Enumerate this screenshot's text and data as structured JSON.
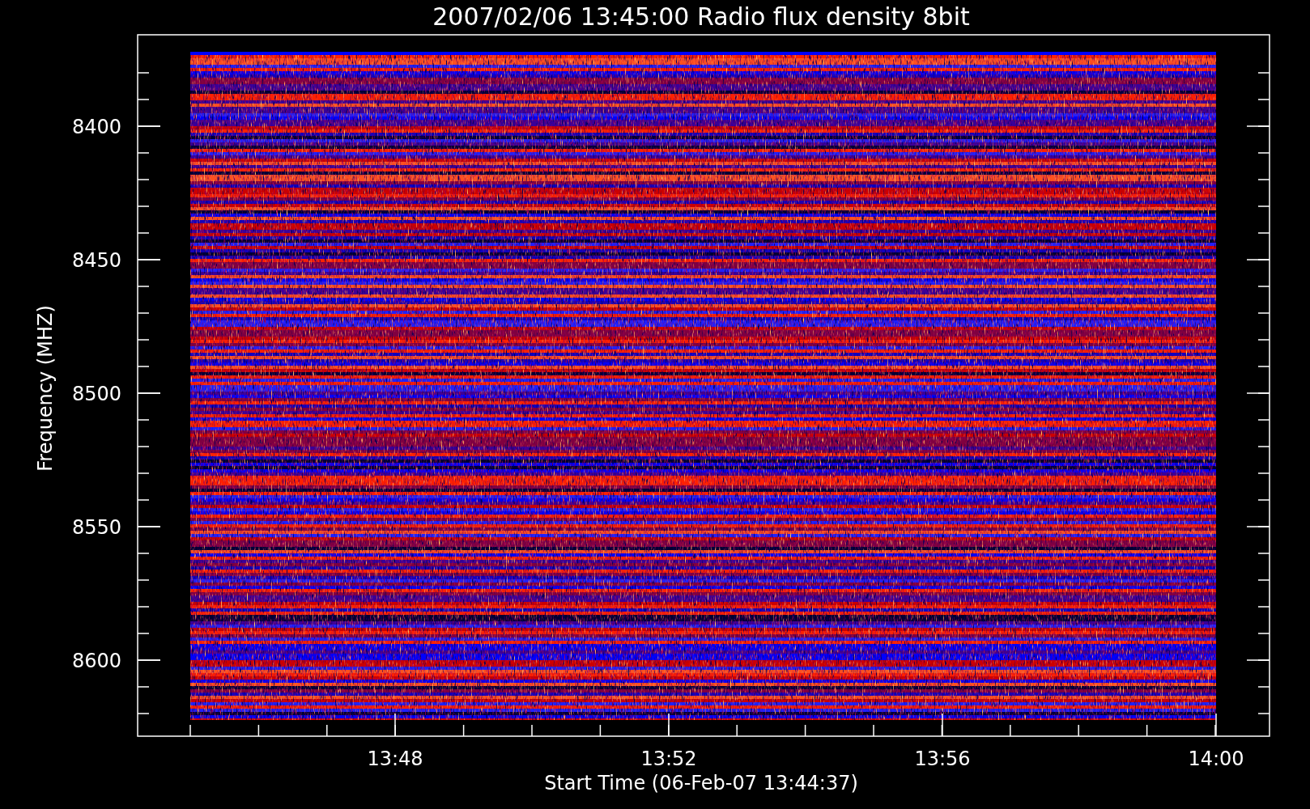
{
  "title": "2007/02/06 13:45:00 Radio flux density 8bit",
  "plot": {
    "ylabel": "Frequency (MHZ)",
    "xlabel": "Start Time (06-Feb-07 13:44:37)",
    "yticks": [
      "8400",
      "8450",
      "8500",
      "8550",
      "8600"
    ],
    "xticks": [
      "13:48",
      "13:52",
      "13:56",
      "14:00"
    ]
  }
}
